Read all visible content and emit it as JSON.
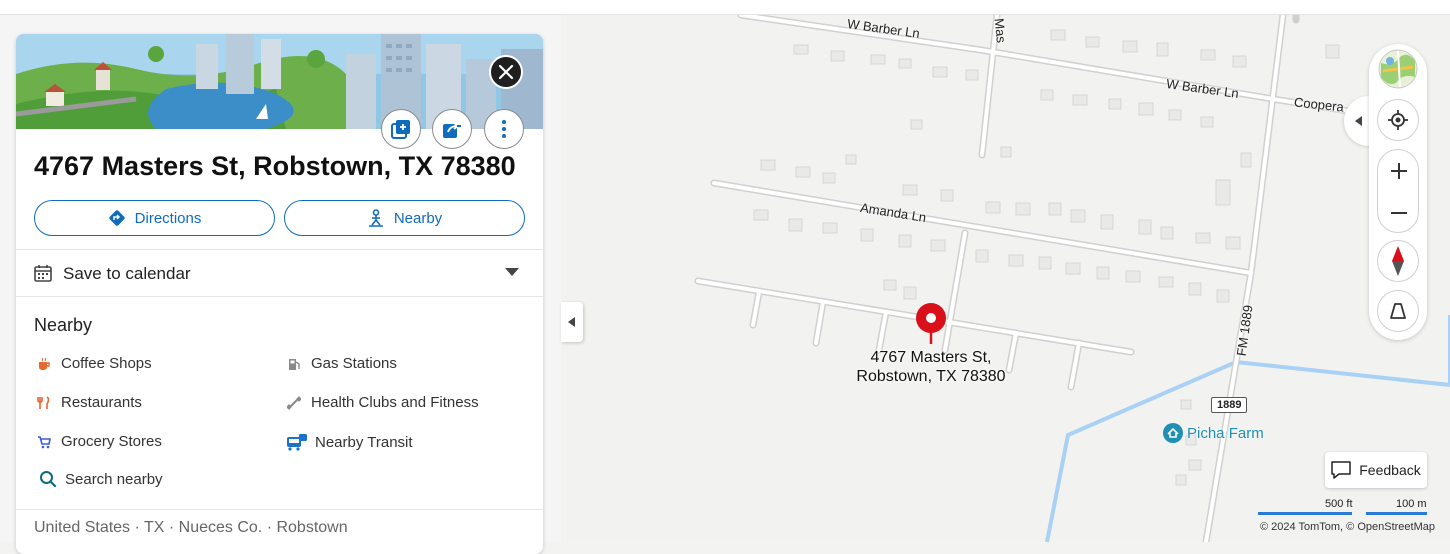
{
  "place": {
    "title": "4767 Masters St, Robstown, TX 78380",
    "directions_label": "Directions",
    "nearby_label": "Nearby",
    "calendar_label": "Save to calendar",
    "nearby_heading": "Nearby",
    "categories": [
      {
        "label": "Coffee Shops",
        "icon": "coffee-icon"
      },
      {
        "label": "Gas Stations",
        "icon": "gas-station-icon"
      },
      {
        "label": "Restaurants",
        "icon": "restaurant-icon"
      },
      {
        "label": "Health Clubs and Fitness",
        "icon": "fitness-icon"
      },
      {
        "label": "Grocery Stores",
        "icon": "cart-icon"
      },
      {
        "label": "Nearby Transit",
        "icon": "transit-icon"
      }
    ],
    "search_nearby_label": "Search nearby",
    "breadcrumb": "United States · TX · Nueces Co. · Robstown"
  },
  "map": {
    "pin_label_line1": "4767 Masters St,",
    "pin_label_line2": "Robstown, TX 78380",
    "roads": {
      "barber_1": "W Barber Ln",
      "barber_2": "W Barber Ln",
      "cooper": "Coopera",
      "amanda": "Amanda Ln",
      "masters_vertical": "Mas",
      "fm": "FM 1889"
    },
    "shield": "1889",
    "poi_label": "Picha Farm",
    "feedback_label": "Feedback",
    "scale_ft": "500 ft",
    "scale_m": "100 m",
    "copyright": "© 2024 TomTom,  © OpenStreetMap",
    "colors": {
      "pin": "#d9101a",
      "accent": "#0f6cbd",
      "water": "#a8d1f5",
      "poi": "#1f8fb3"
    }
  }
}
